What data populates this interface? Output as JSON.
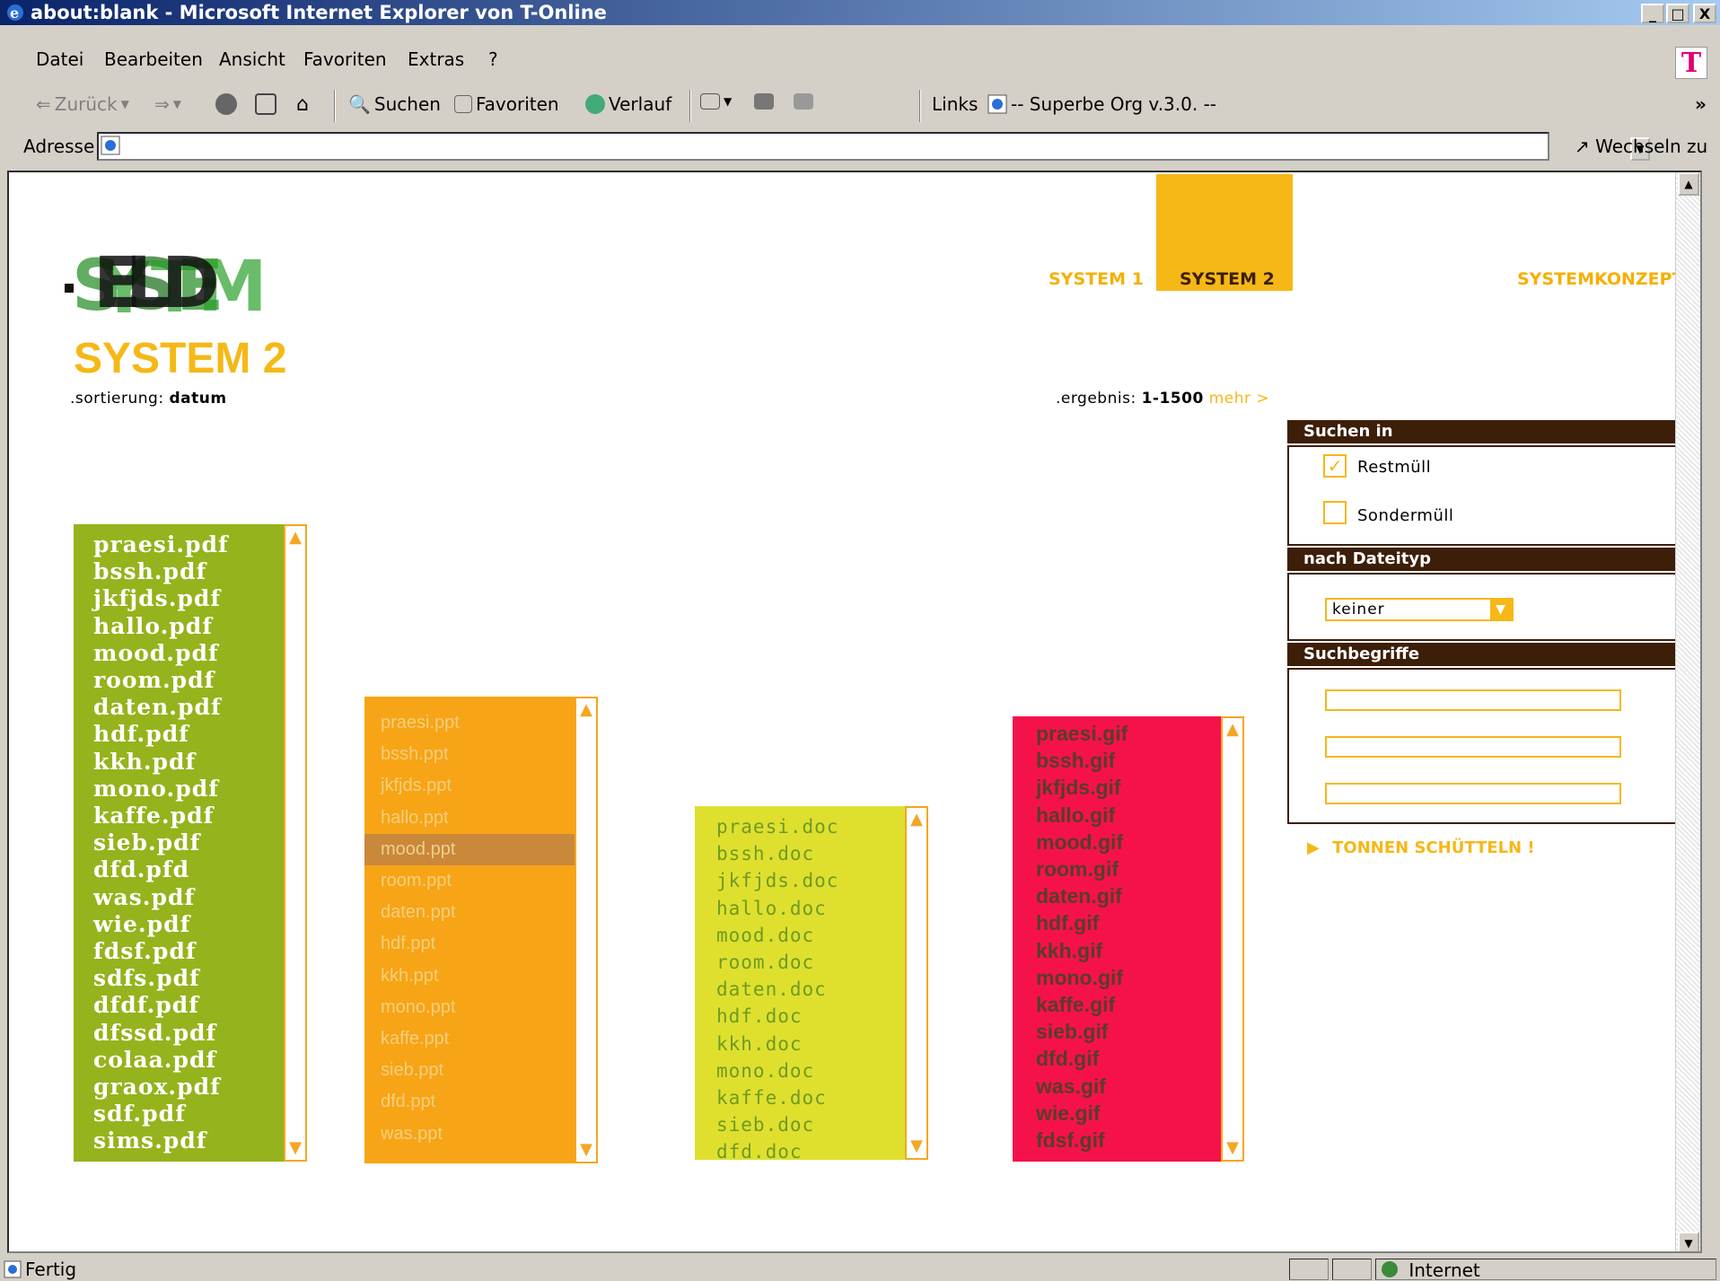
{
  "window": {
    "title": "about:blank - Microsoft Internet Explorer von T-Online",
    "btn_min": "_",
    "btn_max": "□",
    "btn_close": "X"
  },
  "menu": [
    "Datei",
    "Bearbeiten",
    "Ansicht",
    "Favoriten",
    "Extras",
    "?"
  ],
  "toolbar": {
    "back": "Zurück",
    "search": "Suchen",
    "favorites": "Favoriten",
    "history": "Verlauf",
    "links": "Links",
    "links_item": "-- Superbe Org v.3.0. --",
    "overflow": "»"
  },
  "address": {
    "label": "Adresse",
    "value": "",
    "go": "Wechseln zu"
  },
  "status": {
    "text": "Fertig",
    "zone": "Internet"
  },
  "site": {
    "nav": {
      "system1": "SYSTEM 1",
      "system2": "SYSTEM 2",
      "konzept": "SYSTEMKONZEPT"
    },
    "title": "SYSTEM 2",
    "sort_label": ".sortierung:",
    "sort_value": "datum",
    "result_label": ".ergebnis:",
    "result_value": "1-1500",
    "result_more": "mehr >",
    "panel": {
      "search_in": "Suchen in",
      "restmuell": "Restmüll",
      "sondermuell": "Sondermüll",
      "restmuell_checked": true,
      "sondermuell_checked": false,
      "filetype_head": "nach Dateityp",
      "filetype_value": "keiner",
      "terms_head": "Suchbegriffe",
      "shake": "TONNEN SCHÜTTELN !"
    },
    "lists": {
      "pdf": [
        "praesi.pdf",
        "bssh.pdf",
        "jkfjds.pdf",
        "hallo.pdf",
        "mood.pdf",
        "room.pdf",
        "daten.pdf",
        "hdf.pdf",
        "kkh.pdf",
        "mono.pdf",
        "kaffe.pdf",
        "sieb.pdf",
        "dfd.pfd",
        "was.pdf",
        "wie.pdf",
        "fdsf.pdf",
        "sdfs.pdf",
        "dfdf.pdf",
        "dfssd.pdf",
        "colaa.pdf",
        "graox.pdf",
        "sdf.pdf",
        "sims.pdf"
      ],
      "ppt": [
        "praesi.ppt",
        "bssh.ppt",
        "jkfjds.ppt",
        "hallo.ppt",
        "mood.ppt",
        "room.ppt",
        "daten.ppt",
        "hdf.ppt",
        "kkh.ppt",
        "mono.ppt",
        "kaffe.ppt",
        "sieb.ppt",
        "dfd.ppt",
        "was.ppt"
      ],
      "ppt_selected": 4,
      "doc": [
        "praesi.doc",
        "bssh.doc",
        "jkfjds.doc",
        "hallo.doc",
        "mood.doc",
        "room.doc",
        "daten.doc",
        "hdf.doc",
        "kkh.doc",
        "mono.doc",
        "kaffe.doc",
        "sieb.doc",
        "dfd.doc"
      ],
      "gif": [
        "praesi.gif",
        "bssh.gif",
        "jkfjds.gif",
        "hallo.gif",
        "mood.gif",
        "room.gif",
        "daten.gif",
        "hdf.gif",
        "kkh.gif",
        "mono.gif",
        "kaffe.gif",
        "sieb.gif",
        "dfd.gif",
        "was.gif",
        "wie.gif",
        "fdsf.gif"
      ]
    }
  },
  "colors": {
    "accent_yellow": "#f5b817",
    "panel_brown": "#3d1e08",
    "pdf_green": "#95b31c",
    "ppt_orange": "#f7a416",
    "doc_lime": "#dfe02e",
    "gif_red": "#f5124a"
  }
}
